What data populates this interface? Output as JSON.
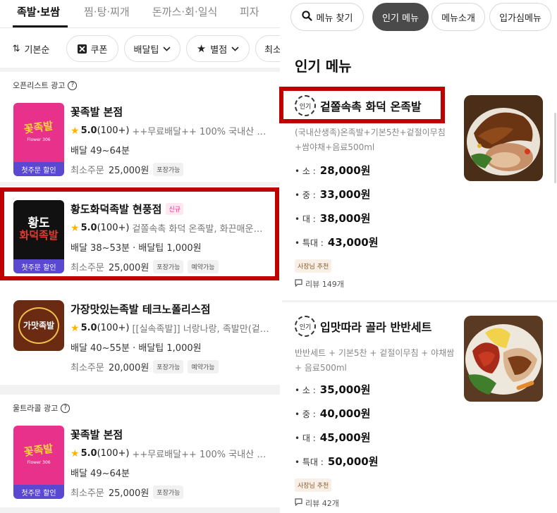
{
  "left": {
    "category_tabs": [
      "족발·보쌈",
      "찜·탕·찌개",
      "돈까스·회·일식",
      "피자"
    ],
    "filters": {
      "sort": "기본순",
      "coupon": "쿠폰",
      "delivery_tip": "배달팁",
      "rating": "별점",
      "more": "최소"
    },
    "section1_label": "오픈리스트 광고",
    "section2_label": "울트라콜 광고",
    "help_glyph": "?",
    "stores": [
      {
        "logo_text": "꽃족발",
        "logo_sub": "Flower 306",
        "logo_badge": "첫주문 할인",
        "name": "꽃족발 본점",
        "new": "",
        "rating": "5.0",
        "reviews": "(100+)",
        "desc": "++무료배달++ 100% 국내산 수…",
        "delivery": "배달 49~64분",
        "min_label": "최소주문",
        "min_value": "25,000원",
        "tags": [
          "포장가능"
        ]
      },
      {
        "logo_text": "황도",
        "logo_text2": "화덕족발",
        "logo_badge": "첫주문 할인",
        "name": "황도화덕족발 현풍점",
        "new": "신규",
        "rating": "5.0",
        "reviews": "(100+)",
        "desc": "겉쫄속촉 화덕 온족발, 화끈매운…",
        "delivery": "배달 38~53분 · 배달팁 1,000원",
        "min_label": "최소주문",
        "min_value": "25,000원",
        "tags": [
          "포장가능",
          "예약가능"
        ]
      },
      {
        "logo_text": "가맛족발",
        "name": "가장맛있는족발 테크노폴리스점",
        "new": "",
        "rating": "5.0",
        "reviews": "(100+)",
        "desc": "[[실속족발]] 너랑나랑, 족발만(겉…",
        "delivery": "배달 40~55분 · 배달팁 1,000원",
        "min_label": "최소주문",
        "min_value": "20,000원",
        "tags": [
          "포장가능",
          "예약가능"
        ]
      },
      {
        "logo_text": "꽃족발",
        "logo_sub": "Flower 306",
        "logo_badge": "첫주문 할인",
        "name": "꽃족발 본점",
        "new": "",
        "rating": "5.0",
        "reviews": "(100+)",
        "desc": "++무료배달++ 100% 국내산 수…",
        "delivery": "배달 49~64분",
        "min_label": "최소주문",
        "min_value": "25,000원",
        "tags": [
          "포장가능"
        ]
      }
    ]
  },
  "right": {
    "pills": [
      "메뉴 찾기",
      "인기 메뉴",
      "메뉴소개",
      "입가심메뉴"
    ],
    "section_title": "인기 메뉴",
    "badge_text": "인기",
    "menus": [
      {
        "name": "겉쫄속촉 화덕 온족발",
        "desc": "(국내산생족)온족발+기본5찬+겉절이무침+쌈야채+음료500ml",
        "prices": [
          {
            "size": "• 소 :",
            "price": "28,000원"
          },
          {
            "size": "• 중 :",
            "price": "33,000원"
          },
          {
            "size": "• 대 :",
            "price": "38,000원"
          },
          {
            "size": "• 특대 :",
            "price": "43,000원"
          }
        ],
        "owner_tag": "사장님 추천",
        "review": "리뷰 149개"
      },
      {
        "name": "입맛따라 골라 반반세트",
        "desc": "반반세트 + 기본5찬 + 겉절이무침 + 야채쌈 + 음료500ml",
        "prices": [
          {
            "size": "• 소 :",
            "price": "35,000원"
          },
          {
            "size": "• 중 :",
            "price": "40,000원"
          },
          {
            "size": "• 대 :",
            "price": "45,000원"
          },
          {
            "size": "• 특대 :",
            "price": "50,000원"
          }
        ],
        "owner_tag": "사장님 추천",
        "review": "리뷰 42개"
      }
    ]
  },
  "colors": {
    "highlight": "#c00000",
    "badge_purple": "#5b48d0",
    "star": "#ffb400",
    "active_pill": "#4a4a4a"
  }
}
